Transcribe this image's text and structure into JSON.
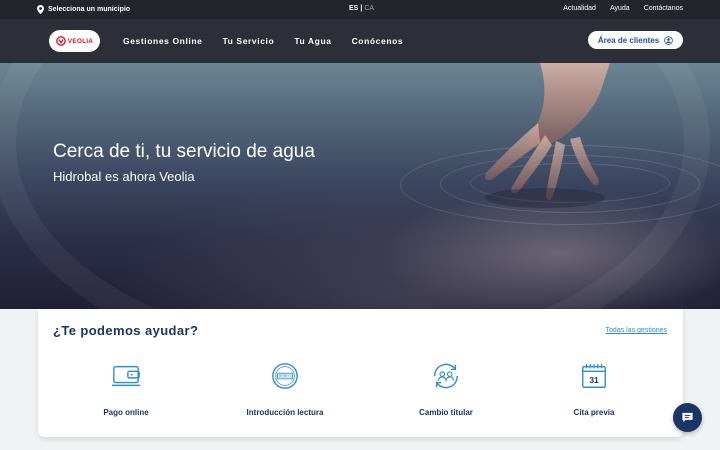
{
  "topbar": {
    "municipality": "Selecciona un municipio",
    "lang_active": "ES",
    "lang_separator": "|",
    "lang_other": "CA",
    "links": [
      "Actualidad",
      "Ayuda",
      "Contáctanos"
    ]
  },
  "nav": {
    "logo_text": "VEOLIA",
    "items": [
      "Gestiones Online",
      "Tu Servicio",
      "Tu Agua",
      "Conócenos"
    ],
    "client_button": "Área de clientes"
  },
  "hero": {
    "title": "Cerca de ti, tu servicio de agua",
    "subtitle": "Hidrobal es ahora Veolia"
  },
  "help": {
    "title": "¿Te podemos ayudar?",
    "all_link": "Todas las gestiones",
    "tiles": [
      {
        "label": "Pago online",
        "icon": "wallet-icon"
      },
      {
        "label": "Introducción lectura",
        "icon": "meter-icon"
      },
      {
        "label": "Cambio titular",
        "icon": "change-owner-icon"
      },
      {
        "label": "Cita previa",
        "icon": "calendar-icon"
      }
    ],
    "calendar_day": "31",
    "meter_reading": "00001"
  },
  "colors": {
    "navy": "#1b3565",
    "accent_blue": "#2d8fc8",
    "brand_red": "#d9121f",
    "topbar": "#23252d",
    "navbar": "#2c2f37"
  }
}
